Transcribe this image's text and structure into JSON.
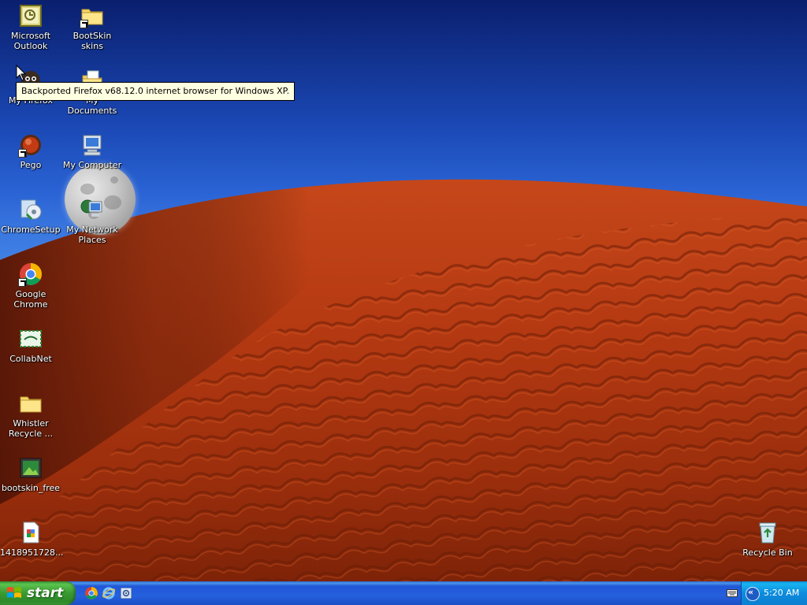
{
  "desktop": {
    "tooltip": "Backported Firefox v68.12.0 internet browser for Windows XP.",
    "icons": [
      {
        "id": "microsoft-outlook",
        "label": "Microsoft\nOutlook",
        "icon": "outlook-icon"
      },
      {
        "id": "bootskin-skins",
        "label": "BootSkin skins",
        "icon": "folder-icon"
      },
      {
        "id": "my-firefox",
        "label": "My Firefox",
        "icon": "firefox-icon"
      },
      {
        "id": "my-documents",
        "label": "My Documents",
        "icon": "documents-icon"
      },
      {
        "id": "pego",
        "label": "Pego",
        "icon": "pego-icon"
      },
      {
        "id": "my-computer",
        "label": "My Computer",
        "icon": "computer-icon"
      },
      {
        "id": "chromesetup",
        "label": "ChromeSetup",
        "icon": "setup-icon"
      },
      {
        "id": "my-network-places",
        "label": "My Network\nPlaces",
        "icon": "network-icon"
      },
      {
        "id": "google-chrome",
        "label": "Google Chrome",
        "icon": "chrome-icon"
      },
      {
        "id": "collabnet",
        "label": "CollabNet",
        "icon": "collabnet-icon"
      },
      {
        "id": "whistler-recycle",
        "label": "Whistler\nRecycle ...",
        "icon": "folder-icon"
      },
      {
        "id": "bootskin-free",
        "label": "bootskin_free",
        "icon": "image-file-icon"
      },
      {
        "id": "file-1418951728",
        "label": "1418951728...",
        "icon": "document-file-icon"
      },
      {
        "id": "recycle-bin",
        "label": "Recycle Bin",
        "icon": "recycle-bin-icon"
      }
    ]
  },
  "taskbar": {
    "start_label": "start",
    "quick_launch": [
      "chrome-icon",
      "internet-explorer-icon",
      "settings-icon"
    ],
    "tray": {
      "time": "5:20 AM",
      "chevron": "«"
    }
  },
  "colors": {
    "taskbar_blue": "#2560dd",
    "start_green": "#3a9a31",
    "tray_blue": "#0d8bdd",
    "tooltip_bg": "#ffffe1",
    "sky_dark": "#0a1f6e",
    "sky_light": "#3f7fe4",
    "sand_red": "#b63a12"
  }
}
